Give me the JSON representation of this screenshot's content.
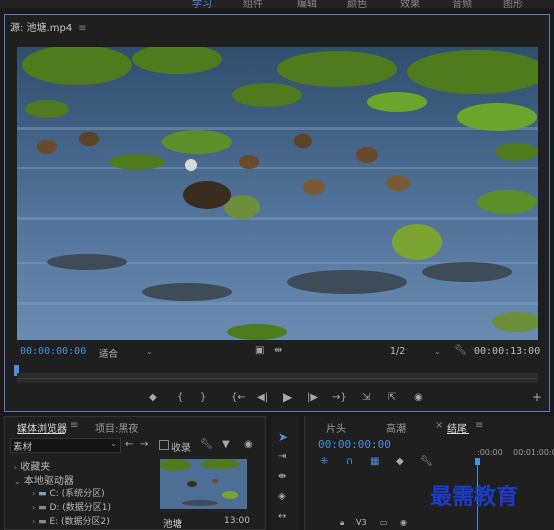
{
  "workspaces": [
    "学习",
    "组件",
    "编辑",
    "颜色",
    "效果",
    "音频",
    "图形"
  ],
  "source_monitor": {
    "tab_title": "源: 池塘.mp4",
    "menu_icon": "hamburger-icon",
    "timecode_current": "00:00:00:00",
    "fit_value": "适合",
    "resolution_value": "1/2",
    "timecode_duration": "00:00:13:00"
  },
  "transport": {
    "icons": [
      "marker-icon",
      "mark-in-icon",
      "mark-out-icon",
      "go-to-in-icon",
      "step-back-icon",
      "play-icon",
      "step-forward-icon",
      "go-to-out-icon",
      "insert-icon",
      "overwrite-icon",
      "export-frame-icon",
      "add-icon"
    ]
  },
  "project_panel": {
    "tabs": [
      "媒体浏览器",
      "项目:黑夜"
    ],
    "active_tab": "媒体浏览器",
    "filter_value": "素材",
    "ingest_label": "收录",
    "tree": [
      {
        "label": "收藏夹",
        "level": 0,
        "expanded": false
      },
      {
        "label": "本地驱动器",
        "level": 0,
        "expanded": true
      },
      {
        "label": "C: (系统分区)",
        "level": 1,
        "expanded": false
      },
      {
        "label": "D: (数据分区1)",
        "level": 1,
        "expanded": false
      },
      {
        "label": "E: (数据分区2)",
        "level": 1,
        "expanded": false
      }
    ],
    "clip": {
      "name": "池塘",
      "duration": "13:00"
    }
  },
  "timeline_panel": {
    "tabs": [
      "片头",
      "高潮",
      "结尾"
    ],
    "active_tab": "结尾",
    "timecode": "00:00:00:00",
    "ruler_labels": [
      ":00:00",
      "00:01:00:00"
    ],
    "track_label": "V3"
  },
  "watermark": "最需教育",
  "colors": {
    "accent": "#4a8fe0",
    "watermark": "#1c3cc8",
    "panel_border": "#5a7cc4"
  }
}
